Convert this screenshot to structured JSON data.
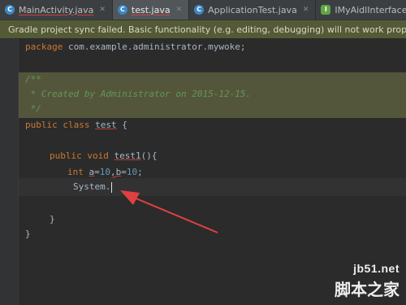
{
  "tabs": [
    {
      "label": "MainActivity.java",
      "icon": "class-icon",
      "underlined": true,
      "active": false
    },
    {
      "label": "test.java",
      "icon": "class-icon",
      "underlined": true,
      "active": true
    },
    {
      "label": "ApplicationTest.java",
      "icon": "class-icon",
      "underlined": false,
      "active": false
    },
    {
      "label": "IMyAidlInterface.aidl",
      "icon": "interface-icon",
      "underlined": false,
      "active": false
    }
  ],
  "notification": {
    "text": "Gradle project sync failed. Basic functionality (e.g. editing, debugging) will not work properly."
  },
  "code": {
    "package_kw": "package",
    "package_name": " com.example.administrator.mywoke;",
    "comment_open": "/**",
    "comment_body": " * Created by Administrator on 2015-12-15.",
    "comment_close": " */",
    "class_kw": "public class",
    "class_name": "test",
    "class_brace": " {",
    "method_kw": "public void",
    "method_name": "test1",
    "method_sig": "(){",
    "int_kw": "int",
    "var_a": "a",
    "eq1": "=",
    "num1": "10",
    "comma": ",",
    "var_b": "b",
    "eq2": "=",
    "num2": "10",
    "semi": ";",
    "typed": "System.",
    "close_method": "}",
    "close_class": "}"
  },
  "watermark": {
    "site": "jb51.net",
    "brand": "脚本之家"
  },
  "colors": {
    "annotation_arrow": "#e04040",
    "notification_bg": "#545a35"
  }
}
